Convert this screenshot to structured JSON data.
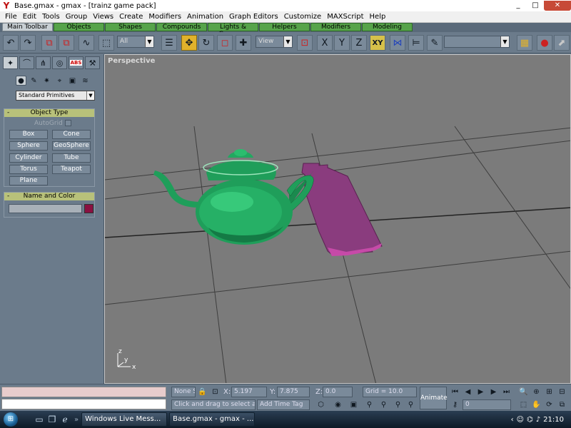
{
  "window": {
    "app_icon": "Y",
    "title": "Base.gmax - gmax - [trainz game pack]",
    "min_glyph": "_",
    "max_glyph": "□",
    "close_glyph": "✕"
  },
  "menu": [
    "File",
    "Edit",
    "Tools",
    "Group",
    "Views",
    "Create",
    "Modifiers",
    "Animation",
    "Graph Editors",
    "Customize",
    "MAXScript",
    "Help"
  ],
  "tabs": [
    "Main Toolbar",
    "Objects",
    "Shapes",
    "Compounds",
    "Lights & Cameras",
    "Helpers",
    "Modifiers",
    "Modeling"
  ],
  "toolbar": {
    "selection_filter": "All",
    "ref_coord": "View",
    "axis_x": "X",
    "axis_y": "Y",
    "axis_z": "Z",
    "axis_xy": "XY",
    "named_selection": ""
  },
  "command_panel": {
    "create_tab_icon": "ABS",
    "category": "Standard Primitives",
    "object_type": {
      "header": "Object Type",
      "autogrid": "AutoGrid",
      "buttons": [
        "Box",
        "Cone",
        "Sphere",
        "GeoSphere",
        "Cylinder",
        "Tube",
        "Torus",
        "Teapot",
        "Plane"
      ]
    },
    "name_color": {
      "header": "Name and Color",
      "name_value": ""
    },
    "collapse_glyph": "-"
  },
  "viewport": {
    "label": "Perspective",
    "axis_x": "x",
    "axis_y": "y",
    "axis_z": "z"
  },
  "status": {
    "selection": "None S",
    "x_label": "X:",
    "x_value": "5.197",
    "y_label": "Y:",
    "y_value": "7.875",
    "z_label": "Z:",
    "z_value": "0.0",
    "grid": "Grid = 10.0",
    "prompt": "Click and drag to select and m",
    "add_time_tag": "Add Time Tag",
    "animate": "Animate",
    "frame": "0"
  },
  "taskbar": {
    "items": [
      "Windows Live Mess...",
      "Base.gmax - gmax - ..."
    ],
    "clock": "21:10"
  },
  "colors": {
    "teapot": "#1f9e5a",
    "plane": "#8a1f72",
    "grid": "#3a3a3a",
    "viewport_bg": "#7b7b7b"
  }
}
